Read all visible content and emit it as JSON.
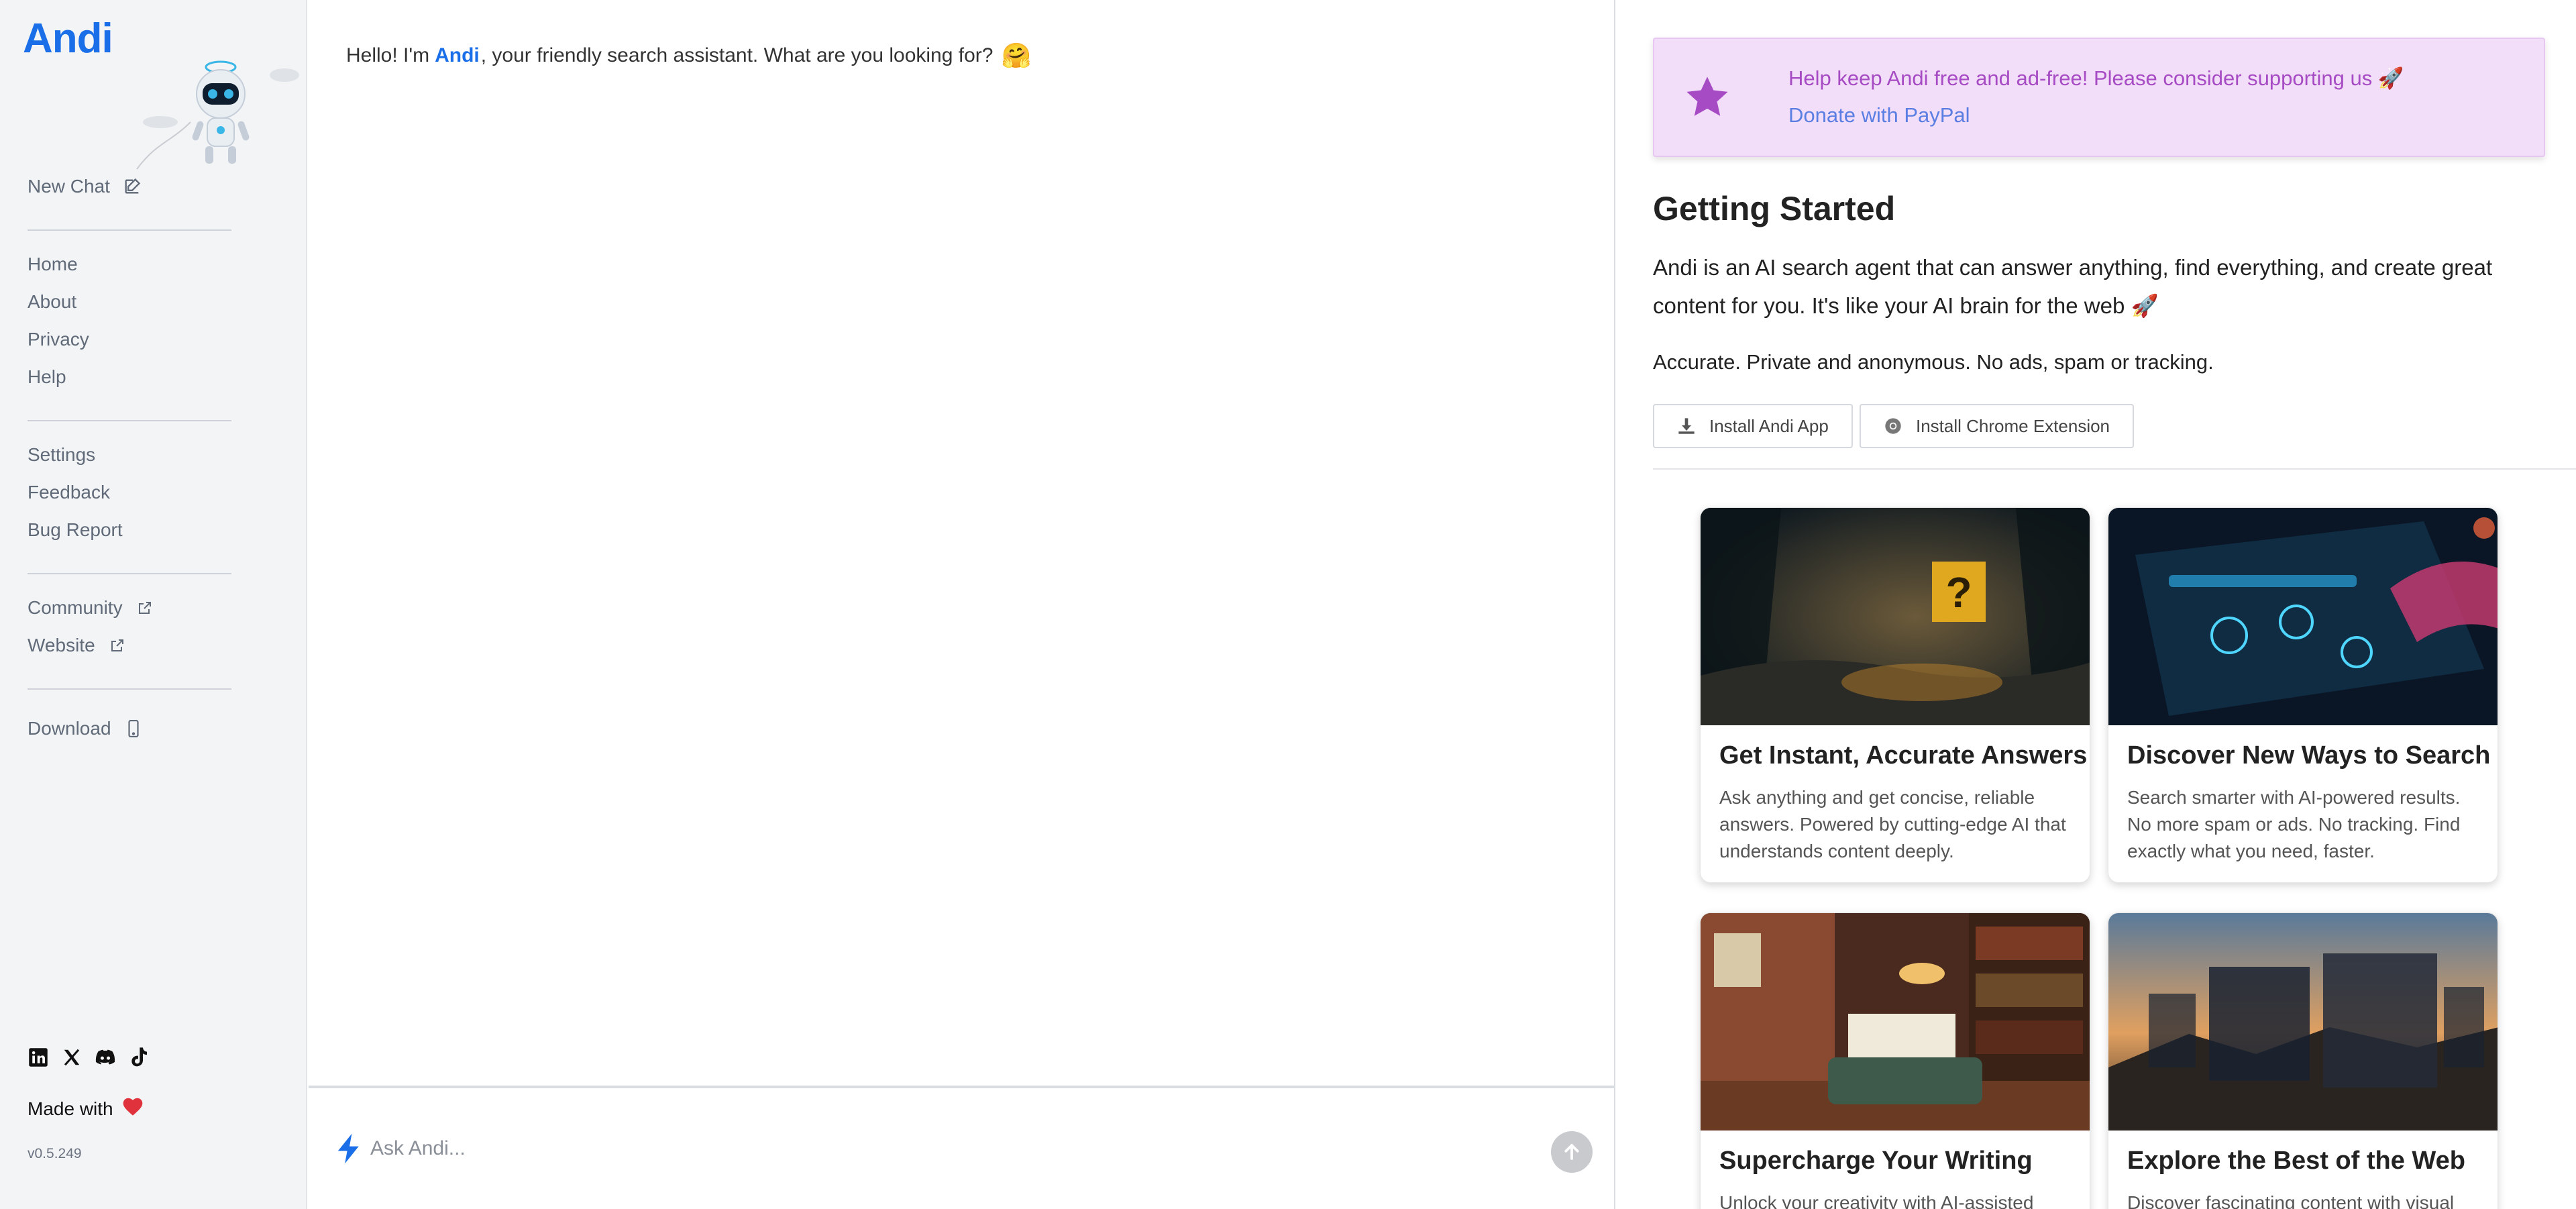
{
  "sidebar": {
    "logo": "Andi",
    "new_chat": "New Chat",
    "nav_main": [
      "Home",
      "About",
      "Privacy",
      "Help"
    ],
    "nav_settings": [
      "Settings",
      "Feedback",
      "Bug Report"
    ],
    "nav_external": [
      "Community",
      "Website"
    ],
    "download": "Download",
    "socials": [
      "linkedin-icon",
      "x-icon",
      "discord-icon",
      "tiktok-icon"
    ],
    "made_with": "Made with",
    "version": "v0.5.249"
  },
  "chat": {
    "greeting_prefix": "Hello! I'm",
    "greeting_brand": "Andi",
    "greeting_suffix": ", your friendly search assistant. What are you looking for?",
    "greeting_emoji": "🤗",
    "input_placeholder": "Ask Andi..."
  },
  "panel": {
    "support_message": "Help keep Andi free and ad-free! Please consider supporting us 🚀",
    "donate_link": "Donate with PayPal",
    "title": "Getting Started",
    "description": "Andi is an AI search agent that can answer anything, find everything, and create great content for you. It's like your AI brain for the web 🚀",
    "tagline": "Accurate. Private and anonymous. No ads, spam or tracking.",
    "install_app": "Install Andi App",
    "install_extension": "Install Chrome Extension",
    "cards": [
      {
        "title": "Get Instant, Accurate Answers",
        "text": "Ask anything and get concise, reliable answers. Powered by cutting-edge AI that understands content deeply."
      },
      {
        "title": "Discover New Ways to Search",
        "text": "Search smarter with AI-powered results. No more spam or ads. No tracking. Find exactly what you need, faster."
      },
      {
        "title": "Supercharge Your Writing",
        "text": "Unlock your creativity with AI-assisted"
      },
      {
        "title": "Explore the Best of the Web",
        "text": "Discover fascinating content with visual"
      }
    ]
  },
  "colors": {
    "brand": "#1a6fe8",
    "support_bg": "#f2def8",
    "support_text": "#a64bc4",
    "donate_link": "#5b7ee3",
    "heart": "#e0323c"
  }
}
